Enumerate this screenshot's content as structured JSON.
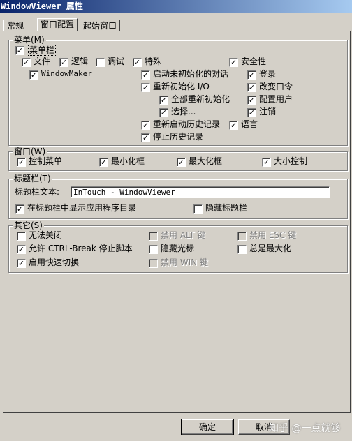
{
  "window": {
    "title": "WindowViewer 属性"
  },
  "tabs": [
    {
      "label": "常规"
    },
    {
      "label": "窗口配置"
    },
    {
      "label": "起始窗口"
    }
  ],
  "menu_group": {
    "legend": "菜单(M)",
    "menubar": "菜单栏",
    "file": "文件",
    "logic": "逻辑",
    "debug": "调试",
    "special": "特殊",
    "security": "安全性",
    "windowmaker": "WindowMaker",
    "start_uninit_dialog": "启动未初始化的对话",
    "reinit_io": "重新初始化 I/O",
    "reinit_all": "全部重新初始化",
    "select": "选择...",
    "restart_history": "重新启动历史记录",
    "stop_history": "停止历史记录",
    "login": "登录",
    "change_password": "改变口令",
    "config_users": "配置用户",
    "logout": "注销",
    "language": "语言"
  },
  "window_group": {
    "legend": "窗口(W)",
    "control_menu": "控制菜单",
    "minimize_box": "最小化框",
    "maximize_box": "最大化框",
    "size_control": "大小控制"
  },
  "titlebar_group": {
    "legend": "标题栏(T)",
    "text_label": "标题栏文本:",
    "text_value": "InTouch - WindowViewer",
    "show_app_dir": "在标题栏中显示应用程序目录",
    "hide_titlebar": "隐藏标题栏"
  },
  "other_group": {
    "legend": "其它(S)",
    "no_close": "无法关闭",
    "disable_alt": "禁用 ALT 键",
    "disable_esc": "禁用 ESC 键",
    "allow_ctrl_break": "允许 CTRL-Break 停止脚本",
    "hide_cursor": "隐藏光标",
    "always_max": "总是最大化",
    "fast_switch": "启用快速切换",
    "disable_win": "禁用 WIN 键"
  },
  "buttons": {
    "ok": "确定",
    "cancel": "取消"
  },
  "watermark": "知乎 @一点就够",
  "check_glyph": "✓",
  "colors": {
    "face": "#d4d0c8",
    "title_start": "#0a246a",
    "title_end": "#a6caf0"
  }
}
